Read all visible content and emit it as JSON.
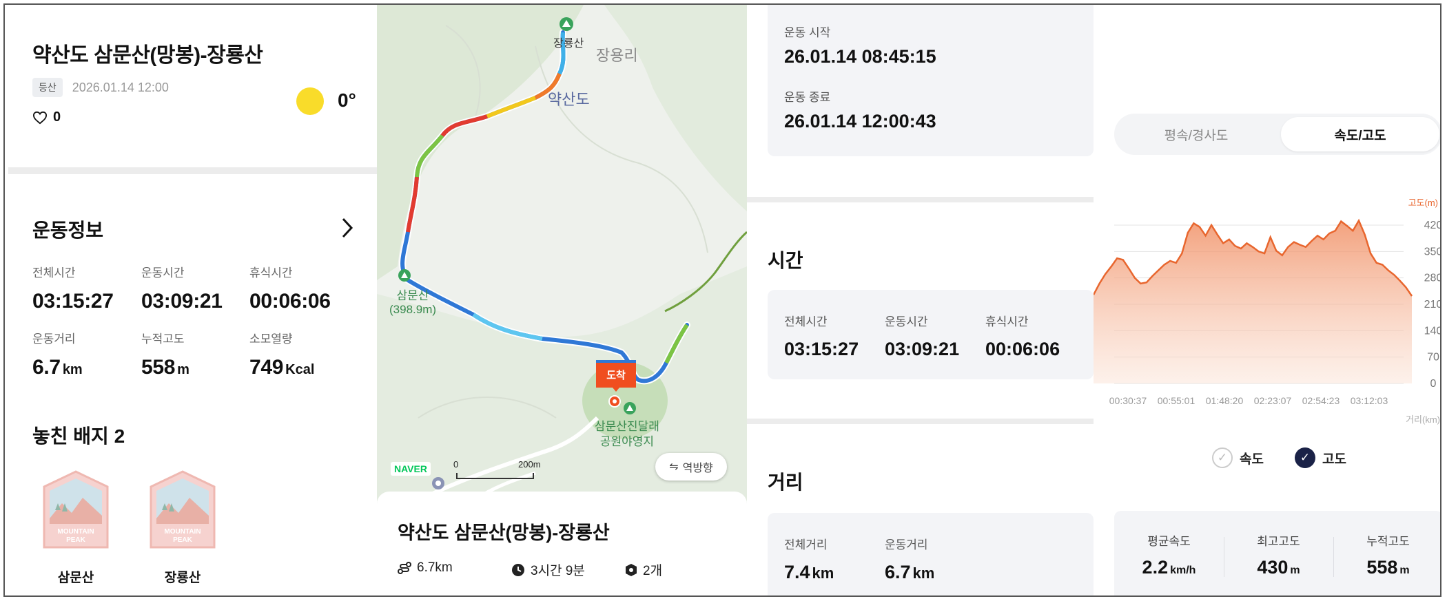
{
  "activity": {
    "title": "약산도 삼문산(망봉)-장룡산",
    "type_tag": "등산",
    "datetime": "2026.01.14 12:00",
    "likes": "0",
    "temperature": "0°"
  },
  "exercise_info": {
    "heading": "운동정보",
    "stats": [
      {
        "label": "전체시간",
        "value": "03:15:27",
        "unit": ""
      },
      {
        "label": "운동시간",
        "value": "03:09:21",
        "unit": ""
      },
      {
        "label": "휴식시간",
        "value": "00:06:06",
        "unit": ""
      },
      {
        "label": "운동거리",
        "value": "6.7",
        "unit": "km"
      },
      {
        "label": "누적고도",
        "value": "558",
        "unit": "m"
      },
      {
        "label": "소모열량",
        "value": "749",
        "unit": "Kcal"
      }
    ]
  },
  "badges": {
    "heading": "놓친 배지 2",
    "items": [
      {
        "name": "삼문산",
        "art_text": "MOUNTAIN PEAK"
      },
      {
        "name": "장룡산",
        "art_text": "MOUNTAIN PEAK"
      }
    ]
  },
  "map": {
    "labels": {
      "peak_top": "장룡산",
      "village": "장용리",
      "island": "약산도",
      "peak_left": "삼문산",
      "peak_left_height": "(398.9m)",
      "campsite_line1": "삼문산진달래",
      "campsite_line2": "공원야영지",
      "arrival": "도착"
    },
    "scale": {
      "zero": "0",
      "distance": "200m"
    },
    "provider": "NAVER",
    "reverse_button": "역방향",
    "card": {
      "title": "약산도 삼문산(망봉)-장룡산",
      "distance": "6.7km",
      "duration": "3시간 9분",
      "badges": "2개"
    }
  },
  "session": {
    "start_label": "운동 시작",
    "start_value": "26.01.14 08:45:15",
    "end_label": "운동 종료",
    "end_value": "26.01.14 12:00:43"
  },
  "time_section": {
    "heading": "시간",
    "stats": [
      {
        "label": "전체시간",
        "value": "03:15:27"
      },
      {
        "label": "운동시간",
        "value": "03:09:21"
      },
      {
        "label": "휴식시간",
        "value": "00:06:06"
      }
    ]
  },
  "distance_section": {
    "heading": "거리",
    "stats": [
      {
        "label": "전체거리",
        "value": "7.4",
        "unit": "km"
      },
      {
        "label": "운동거리",
        "value": "6.7",
        "unit": "km"
      }
    ]
  },
  "chart_toggle": {
    "tab_left": "평속/경사도",
    "tab_right": "속도/고도",
    "selected": "속도/고도"
  },
  "chart_data": {
    "type": "area",
    "ylabel": "고도(m)",
    "xlabel": "거리(km)",
    "ylim": [
      0,
      420
    ],
    "yticks": [
      0,
      70,
      140,
      210,
      280,
      350,
      420
    ],
    "xtick_labels": [
      "00:30:37",
      "00:55:01",
      "01:48:20",
      "02:23:07",
      "02:54:23",
      "03:12:03"
    ],
    "series": [
      {
        "name": "고도",
        "color": "#e8662e",
        "values": [
          235,
          265,
          290,
          310,
          332,
          328,
          305,
          280,
          265,
          268,
          285,
          300,
          315,
          325,
          320,
          345,
          400,
          425,
          415,
          392,
          420,
          395,
          372,
          382,
          365,
          358,
          372,
          362,
          350,
          345,
          388,
          352,
          340,
          362,
          375,
          368,
          362,
          378,
          392,
          382,
          398,
          405,
          430,
          418,
          405,
          432,
          395,
          345,
          320,
          315,
          300,
          288,
          272,
          255,
          232
        ]
      }
    ],
    "legend": [
      {
        "label": "속도",
        "checked": false
      },
      {
        "label": "고도",
        "checked": true
      }
    ]
  },
  "summary": [
    {
      "label": "평균속도",
      "value": "2.2",
      "unit": "km/h"
    },
    {
      "label": "최고고도",
      "value": "430",
      "unit": "m"
    },
    {
      "label": "누적고도",
      "value": "558",
      "unit": "m"
    }
  ],
  "colors": {
    "accent_orange": "#e8662e",
    "arrival_red": "#f04e1f",
    "route_blue": "#2f78d6",
    "checked_navy": "#1a2247",
    "sun": "#f9dc2a"
  }
}
